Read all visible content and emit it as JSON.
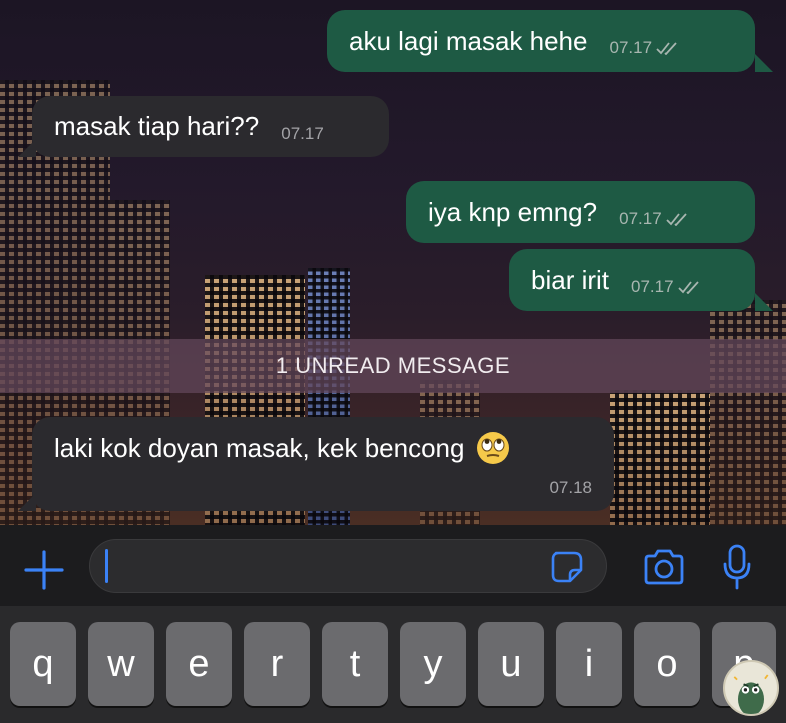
{
  "messages": [
    {
      "direction": "outgoing",
      "text": "aku lagi masak hehe",
      "time": "07.17",
      "status": "read"
    },
    {
      "direction": "incoming",
      "text": "masak tiap hari??",
      "time": "07.17"
    },
    {
      "direction": "outgoing",
      "text": "iya knp emng?",
      "time": "07.17",
      "status": "read"
    },
    {
      "direction": "outgoing",
      "text": "biar irit",
      "time": "07.17",
      "status": "read"
    },
    {
      "direction": "incoming",
      "text": "laki kok doyan masak, kek bencong",
      "time": "07.18",
      "emoji": "face-with-rolling-eyes"
    }
  ],
  "unread_banner": "1 UNREAD MESSAGE",
  "input": {
    "value": "",
    "placeholder": ""
  },
  "keyboard": {
    "row1": [
      "q",
      "w",
      "e",
      "r",
      "t",
      "y",
      "u",
      "i",
      "o",
      "p"
    ]
  },
  "icons": {
    "attach": "plus-icon",
    "sticker": "sticker-icon",
    "camera": "camera-icon",
    "mic": "microphone-icon"
  },
  "colors": {
    "outgoing_bubble": "#1e5a44",
    "incoming_bubble": "#2b2a2e",
    "accent": "#3b82f6"
  }
}
